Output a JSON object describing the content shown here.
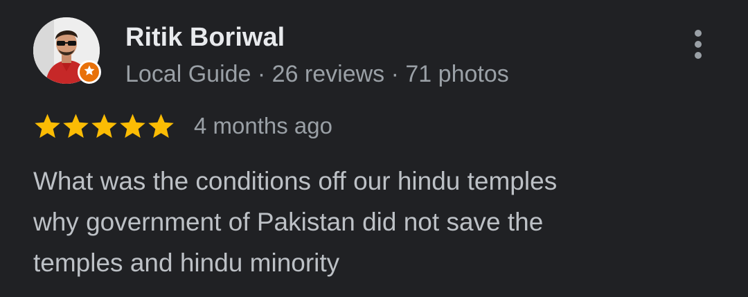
{
  "reviewer": {
    "name": "Ritik Boriwal",
    "meta": "Local Guide · 26 reviews · 71 photos",
    "badge_icon": "local-guide-star-icon",
    "badge_color": "#e8710a"
  },
  "review": {
    "rating": 5,
    "max_rating": 5,
    "star_color": "#fbbc04",
    "time": "4 months ago",
    "text_lines": [
      "What was the conditions off our hindu temples",
      "why government of Pakistan did not save the",
      "temples and hindu minority"
    ]
  },
  "menu": {
    "icon": "more-vert-icon"
  }
}
